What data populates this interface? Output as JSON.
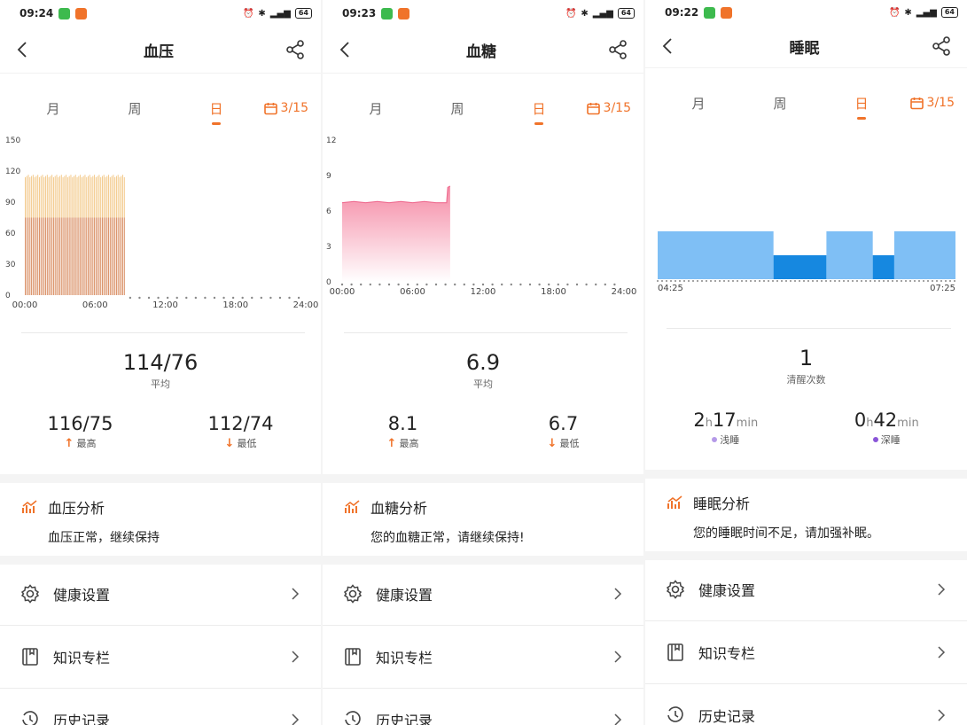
{
  "colors": {
    "accent": "#f0732a",
    "bp_systolic": "#f3c98a",
    "bp_diastolic": "#d98d62",
    "glucose": "#f58aa5",
    "light_sleep": "#7fbff5",
    "deep_sleep": "#1688e0"
  },
  "screens": [
    {
      "status": {
        "time": "09:24",
        "battery": "64"
      },
      "title": "血压",
      "tabs": [
        "月",
        "周",
        "日"
      ],
      "active_tab": "日",
      "date": "3/15",
      "summary": {
        "value": "114/76",
        "caption": "平均"
      },
      "left": {
        "value": "116/75",
        "label": "最高"
      },
      "right": {
        "value": "112/74",
        "label": "最低"
      },
      "analysis": {
        "title": "血压分析",
        "text": "血压正常，继续保持"
      },
      "menu": [
        "健康设置",
        "知识专栏",
        "历史记录"
      ]
    },
    {
      "status": {
        "time": "09:23",
        "battery": "64"
      },
      "title": "血糖",
      "tabs": [
        "月",
        "周",
        "日"
      ],
      "active_tab": "日",
      "date": "3/15",
      "summary": {
        "value": "6.9",
        "caption": "平均"
      },
      "left": {
        "value": "8.1",
        "label": "最高"
      },
      "right": {
        "value": "6.7",
        "label": "最低"
      },
      "analysis": {
        "title": "血糖分析",
        "text": "您的血糖正常，请继续保持!"
      },
      "menu": [
        "健康设置",
        "知识专栏",
        "历史记录"
      ]
    },
    {
      "status": {
        "time": "09:22",
        "battery": "64"
      },
      "title": "睡眠",
      "tabs": [
        "月",
        "周",
        "日"
      ],
      "active_tab": "日",
      "date": "3/15",
      "summary": {
        "value": "1",
        "caption": "清醒次数"
      },
      "left": {
        "h": "2",
        "min": "17",
        "label": "浅睡",
        "unit_h": "h",
        "unit_min": "min"
      },
      "right": {
        "h": "0",
        "min": "42",
        "label": "深睡",
        "unit_h": "h",
        "unit_min": "min"
      },
      "analysis": {
        "title": "睡眠分析",
        "text": "您的睡眠时间不足，请加强补眠。"
      },
      "menu": [
        "健康设置",
        "知识专栏",
        "历史记录"
      ]
    }
  ],
  "chart_data": [
    {
      "type": "bar",
      "title": "",
      "y_ticks": [
        0,
        30,
        60,
        90,
        120,
        150
      ],
      "ylim": [
        0,
        150
      ],
      "x_ticks": [
        "00:00",
        "06:00",
        "12:00",
        "18:00",
        "24:00"
      ],
      "xlim_hours": [
        0,
        24
      ],
      "series": [
        {
          "name": "",
          "values_desc": "systolic",
          "start_hour": 0,
          "end_hour": 8.6,
          "value": 114
        },
        {
          "name": "",
          "values_desc": "diastolic",
          "start_hour": 0,
          "end_hour": 8.6,
          "value": 75
        }
      ]
    },
    {
      "type": "area",
      "title": "",
      "y_ticks": [
        0,
        3,
        6,
        9,
        12
      ],
      "ylim": [
        0,
        12
      ],
      "x_ticks": [
        "00:00",
        "06:00",
        "12:00",
        "18:00",
        "24:00"
      ],
      "xlim_hours": [
        0,
        24
      ],
      "series": [
        {
          "name": "",
          "points": [
            [
              0,
              6.7
            ],
            [
              1,
              6.8
            ],
            [
              2,
              6.7
            ],
            [
              3,
              6.8
            ],
            [
              4,
              6.7
            ],
            [
              5,
              6.8
            ],
            [
              6,
              6.7
            ],
            [
              7,
              6.8
            ],
            [
              8,
              6.7
            ],
            [
              8.9,
              6.7
            ],
            [
              9.0,
              8.0
            ],
            [
              9.2,
              8.1
            ]
          ]
        }
      ]
    },
    {
      "type": "bar",
      "title": "",
      "x_ticks": [
        "04:25",
        "07:25"
      ],
      "segments": [
        {
          "stage": "light",
          "start": "04:25",
          "end": "05:35"
        },
        {
          "stage": "deep",
          "start": "05:35",
          "end": "06:07"
        },
        {
          "stage": "light",
          "start": "06:07",
          "end": "06:35"
        },
        {
          "stage": "deep",
          "start": "06:35",
          "end": "06:48"
        },
        {
          "stage": "light",
          "start": "06:48",
          "end": "07:25"
        }
      ]
    }
  ]
}
